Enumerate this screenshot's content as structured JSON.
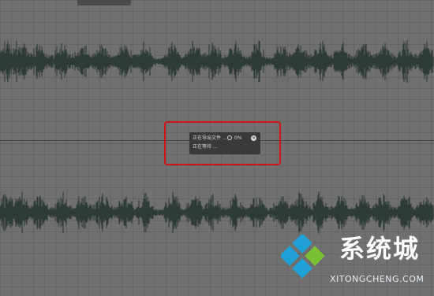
{
  "editor": {
    "background_color": "#707070",
    "waveform_color": "#2f3b36"
  },
  "export_dialog": {
    "status_text": "正在导出文件 ...",
    "progress_text": "0%",
    "waiting_text": "正在等待 ...",
    "spinner_icon": "spinner-icon",
    "close_icon": "close-icon",
    "highlight_color": "#d0141a"
  },
  "watermark": {
    "brand_text": "系统城",
    "url_text": "XITONGCHENG.COM",
    "logo_icon": "diamond-logo-icon",
    "logo_colors": [
      "#21a0d8",
      "#7cc034",
      "#21a0d8",
      "#21a0d8"
    ]
  }
}
